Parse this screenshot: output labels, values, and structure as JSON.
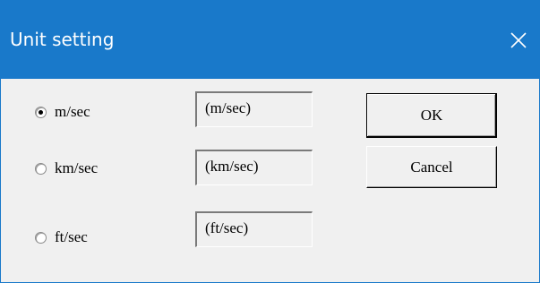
{
  "window": {
    "title": "Unit setting",
    "close_icon": "close-icon"
  },
  "units": [
    {
      "label": "m/sec",
      "value": "(m/sec)",
      "selected": true
    },
    {
      "label": "km/sec",
      "value": "(km/sec)",
      "selected": false
    },
    {
      "label": "ft/sec",
      "value": "(ft/sec)",
      "selected": false
    }
  ],
  "buttons": {
    "ok_label": "OK",
    "cancel_label": "Cancel"
  },
  "colors": {
    "titlebar": "#1979ca",
    "dialog_background": "#f0f0f0"
  }
}
